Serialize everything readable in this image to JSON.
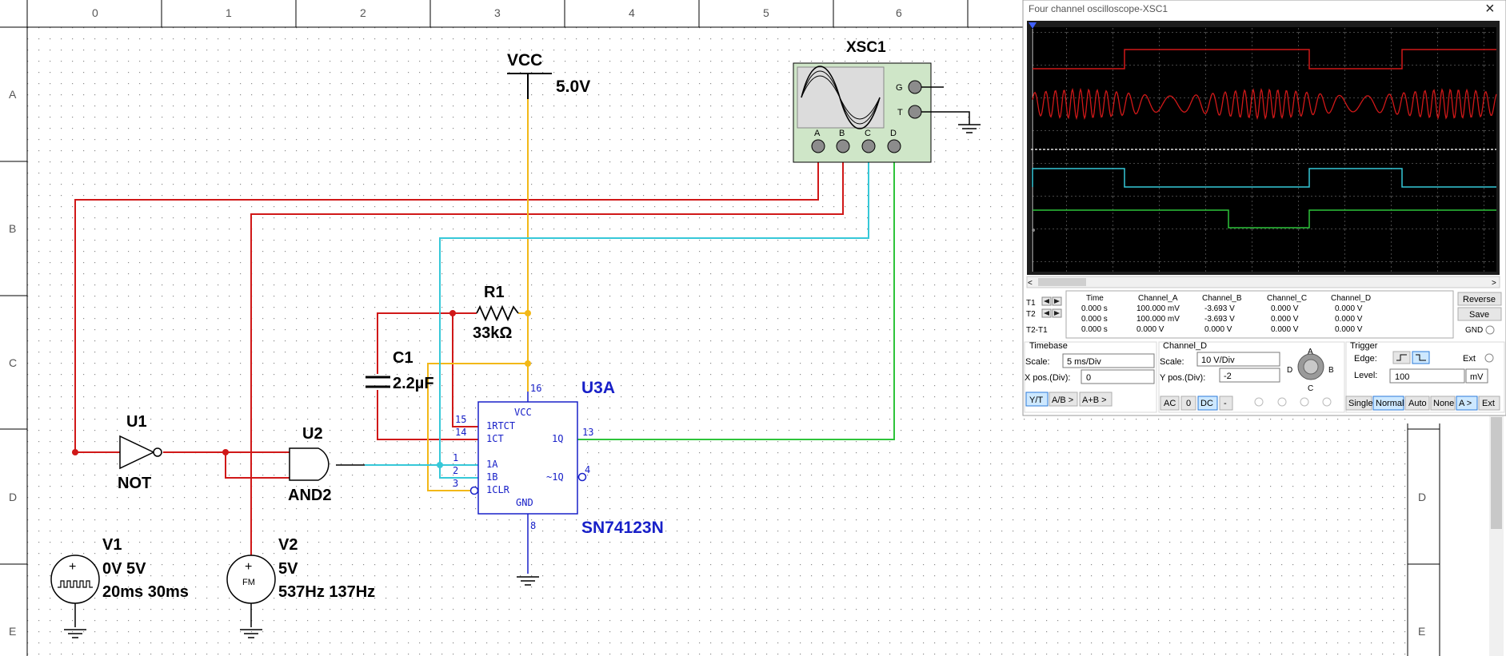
{
  "grid": {
    "columns": [
      "0",
      "1",
      "2",
      "3",
      "4",
      "5",
      "6"
    ],
    "rows_left": [
      "A",
      "B",
      "C",
      "D",
      "E"
    ],
    "rows_right": [
      "C",
      "D",
      "E"
    ]
  },
  "components": {
    "vcc": {
      "name": "VCC",
      "value": "5.0V"
    },
    "scope": {
      "name": "XSC1",
      "terminals": [
        "A",
        "B",
        "C",
        "D"
      ],
      "g": "G",
      "t": "T"
    },
    "r1": {
      "name": "R1",
      "value": "33kΩ"
    },
    "c1": {
      "name": "C1",
      "value": "2.2µF"
    },
    "u1": {
      "name": "U1",
      "type": "NOT"
    },
    "u2": {
      "name": "U2",
      "type": "AND2"
    },
    "u3": {
      "name": "U3A",
      "part": "SN74123N",
      "pins": {
        "p16": "16",
        "p15": "15",
        "p14": "14",
        "p1": "1",
        "p2": "2",
        "p3": "3",
        "p13": "13",
        "p4": "4",
        "p8": "8"
      },
      "labels": {
        "vcc": "VCC",
        "rtct": "1RTCT",
        "ct": "1CT",
        "a": "1A",
        "b": "1B",
        "clr": "1CLR",
        "q": "1Q",
        "nq": "~1Q",
        "gnd": "GND"
      }
    },
    "v1": {
      "name": "V1",
      "line1": "0V 5V",
      "line2": "20ms 30ms"
    },
    "v2": {
      "name": "V2",
      "line1": "5V",
      "line2": "537Hz 137Hz",
      "symbol": "FM"
    }
  },
  "colors": {
    "red": "#d01818",
    "cyan": "#36c8d8",
    "green": "#2ec43a",
    "orange": "#f2b818",
    "blue": "#1820c8",
    "scope_bg": "#000000"
  },
  "scope_window": {
    "title": "Four channel oscilloscope-XSC1",
    "close_icon": "×",
    "readout": {
      "headers": [
        "",
        "Time",
        "Channel_A",
        "Channel_B",
        "Channel_C",
        "Channel_D"
      ],
      "rows": [
        [
          "T1",
          "0.000 s",
          "100.000 mV",
          "-3.693 V",
          "0.000 V",
          "0.000 V"
        ],
        [
          "T2",
          "0.000 s",
          "100.000 mV",
          "-3.693 V",
          "0.000 V",
          "0.000 V"
        ],
        [
          "T2-T1",
          "0.000 s",
          "0.000 V",
          "0.000 V",
          "0.000 V",
          "0.000 V"
        ]
      ]
    },
    "buttons": {
      "reverse": "Reverse",
      "save": "Save",
      "gnd": "GND"
    },
    "timebase": {
      "title": "Timebase",
      "scale_label": "Scale:",
      "scale_value": "5 ms/Div",
      "xpos_label": "X pos.(Div):",
      "xpos_value": "0",
      "modes": [
        "Y/T",
        "A/B >",
        "A+B >"
      ]
    },
    "channel": {
      "title": "Channel_D",
      "scale_label": "Scale:",
      "scale_value": "10  V/Div",
      "ypos_label": "Y pos.(Div):",
      "ypos_value": "-2",
      "coupling": [
        "AC",
        "0",
        "DC",
        "-"
      ],
      "knob_labels": {
        "a": "A",
        "b": "B",
        "c": "C",
        "d": "D"
      }
    },
    "trigger": {
      "title": "Trigger",
      "edge_label": "Edge:",
      "ext": "Ext",
      "level_label": "Level:",
      "level_value": "100",
      "level_unit": "mV",
      "modes": [
        "Single",
        "Normal",
        "Auto",
        "None",
        "A >",
        "Ext"
      ]
    }
  }
}
